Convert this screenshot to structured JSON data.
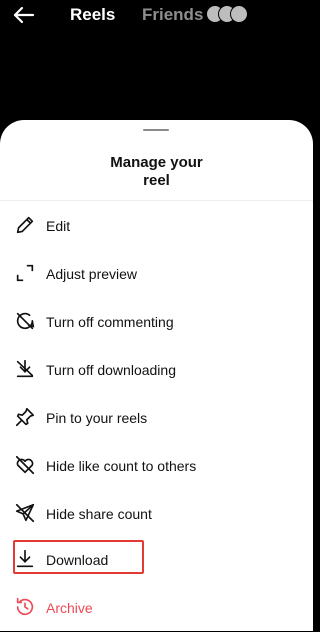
{
  "header": {
    "reels_tab": "Reels",
    "friends_tab": "Friends"
  },
  "sheet": {
    "title": "Manage your\nreel",
    "items": [
      {
        "label": "Edit",
        "icon": "pencil-icon"
      },
      {
        "label": "Adjust preview",
        "icon": "crop-corners-icon"
      },
      {
        "label": "Turn off commenting",
        "icon": "comment-off-icon"
      },
      {
        "label": "Turn off downloading",
        "icon": "download-off-icon"
      },
      {
        "label": "Pin to your reels",
        "icon": "pin-icon"
      },
      {
        "label": "Hide like count to others",
        "icon": "heart-off-icon"
      },
      {
        "label": "Hide share count",
        "icon": "share-off-icon"
      },
      {
        "label": "Download",
        "icon": "download-icon"
      },
      {
        "label": "Archive",
        "icon": "archive-clock-icon"
      }
    ]
  },
  "colors": {
    "danger": "#ed4956",
    "highlight": "#e53935"
  }
}
